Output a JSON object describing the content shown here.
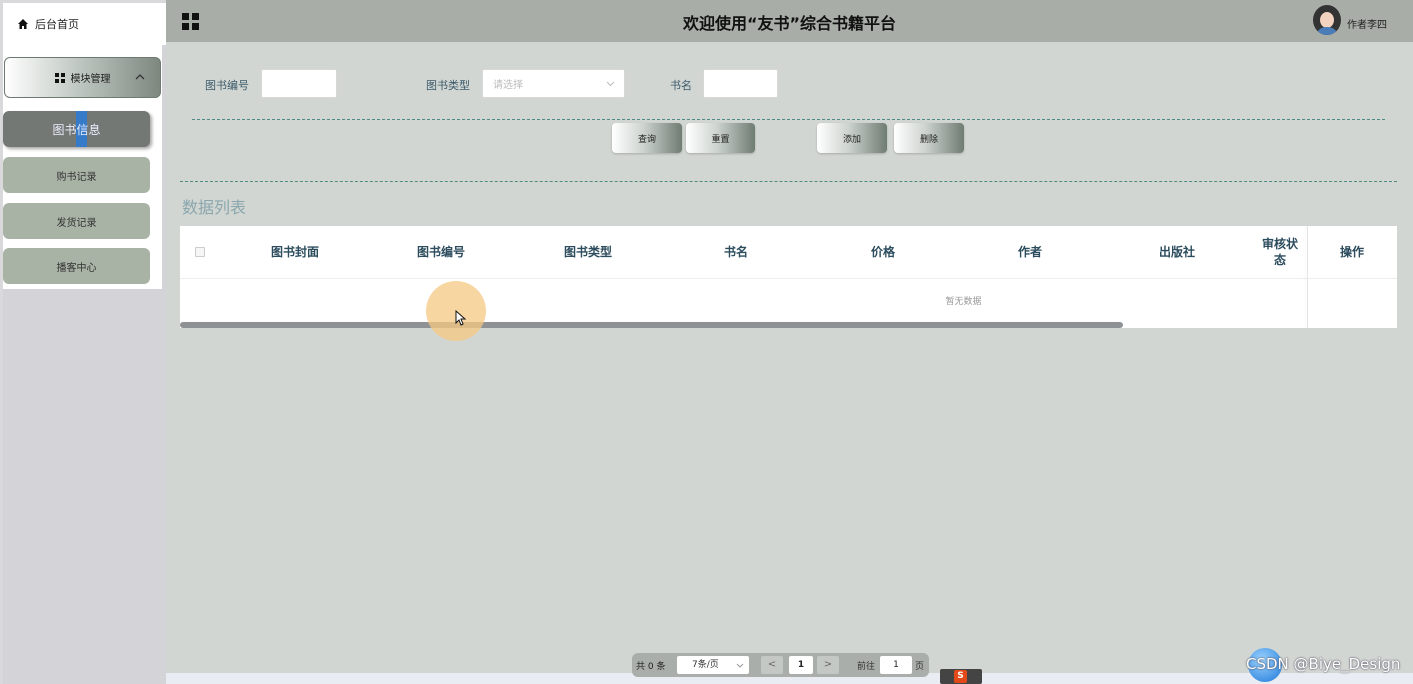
{
  "sidebar": {
    "home_label": "后台首页",
    "module_label": "模块管理",
    "items": [
      {
        "label": "图书信息",
        "active": true
      },
      {
        "label": "购书记录"
      },
      {
        "label": "发货记录"
      },
      {
        "label": "播客中心"
      }
    ]
  },
  "header": {
    "title": "欢迎使用“友书”综合书籍平台",
    "user_name": "作者李四"
  },
  "search": {
    "book_no_label": "图书编号",
    "book_type_label": "图书类型",
    "book_type_placeholder": "请选择",
    "book_name_label": "书名",
    "buttons": {
      "query": "查询",
      "reset": "重置",
      "add": "添加",
      "delete": "删除"
    }
  },
  "list": {
    "title": "数据列表",
    "columns": [
      "图书封面",
      "图书编号",
      "图书类型",
      "书名",
      "价格",
      "作者",
      "出版社",
      "审核状态",
      "操作"
    ],
    "empty_text": "暂无数据"
  },
  "pagination": {
    "total": "共 0 条",
    "page_size": "7条/页",
    "prev": "<",
    "current_page": "1",
    "next": ">",
    "goto_label": "前往",
    "goto_value": "1",
    "page_suffix": "页"
  },
  "watermark": "CSDN @Biye_Design"
}
